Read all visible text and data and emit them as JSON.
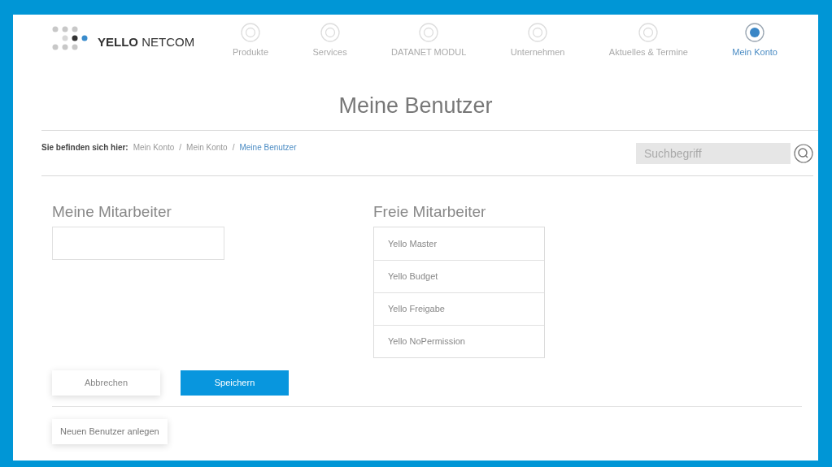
{
  "brand": {
    "bold": "YELLO",
    "rest": "NETCOM"
  },
  "nav": [
    {
      "label": "Produkte",
      "selected": false
    },
    {
      "label": "Services",
      "selected": false
    },
    {
      "label": "DATANET MODUL",
      "selected": false
    },
    {
      "label": "Unternehmen",
      "selected": false
    },
    {
      "label": "Aktuelles & Termine",
      "selected": false
    },
    {
      "label": "Mein Konto",
      "selected": true
    }
  ],
  "title": "Meine Benutzer",
  "breadcrumb": {
    "prefix": "Sie befinden sich hier:",
    "items": [
      {
        "label": "Mein Konto",
        "selected": false
      },
      {
        "label": "Mein Konto",
        "selected": false
      },
      {
        "label": "Meine Benutzer",
        "selected": true
      }
    ],
    "separator": "/"
  },
  "search": {
    "placeholder": "Suchbegriff"
  },
  "my_staff": {
    "heading": "Meine Mitarbeiter"
  },
  "free_staff": {
    "heading": "Freie Mitarbeiter",
    "items": [
      "Yello Master",
      "Yello Budget",
      "Yello Freigabe",
      "Yello NoPermission"
    ]
  },
  "buttons": [
    {
      "label": "Abbrechen",
      "kind": "secondary"
    },
    {
      "label": "Speichern",
      "kind": "primary"
    }
  ],
  "new_user_button": "Neuen Benutzer anlegen"
}
